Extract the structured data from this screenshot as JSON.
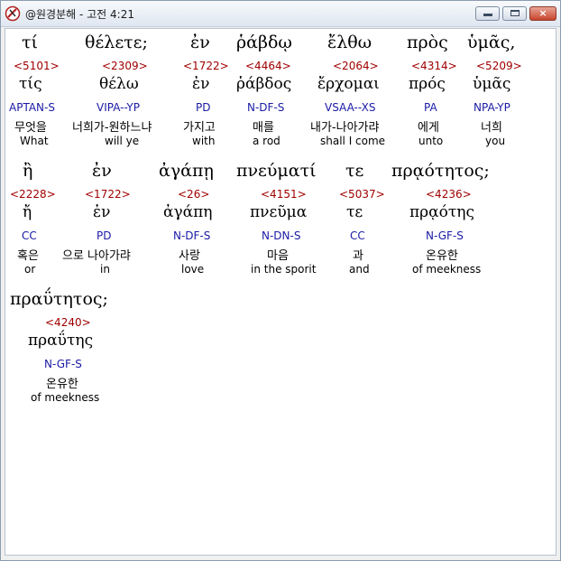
{
  "window": {
    "title": "@원경분해 - 고전 4:21",
    "buttons": {
      "minimize": "minimize-button",
      "maximize": "maximize-button",
      "close": "×"
    }
  },
  "colors": {
    "strong": "#a00000",
    "morph": "#1a1aa6",
    "text": "#000000"
  },
  "words": [
    {
      "greek": "τί",
      "strong": "<5101>",
      "lemma": "τίς",
      "morph": "APTAN-S",
      "korean": "무엇을",
      "english": "What"
    },
    {
      "greek": "θέλετε;",
      "strong": "<2309>",
      "lemma": "θέλω",
      "morph": "VIPA--YP",
      "korean": "너희가-원하느냐",
      "english": "will ye"
    },
    {
      "greek": "ἐν",
      "strong": "<1722>",
      "lemma": "ἐν",
      "morph": "PD",
      "korean": "가지고",
      "english": "with"
    },
    {
      "greek": "ῥάβδῳ",
      "strong": "<4464>",
      "lemma": "ῥάβδος",
      "morph": "N-DF-S",
      "korean": "매를",
      "english": "a rod"
    },
    {
      "greek": "ἔλθω",
      "strong": "<2064>",
      "lemma": "ἔρχομαι",
      "morph": "VSAA--XS",
      "korean": "내가-나아가랴",
      "english": "shall I come"
    },
    {
      "greek": "πρὸς",
      "strong": "<4314>",
      "lemma": "πρός",
      "morph": "PA",
      "korean": "에게",
      "english": "unto"
    },
    {
      "greek": "ὑμᾶς,",
      "strong": "<5209>",
      "lemma": "ὑμᾶς",
      "morph": "NPA-YP",
      "korean": "너희",
      "english": "you"
    },
    {
      "greek": "ἢ",
      "strong": "<2228>",
      "lemma": "ἤ",
      "morph": "CC",
      "korean": "혹은",
      "english": "or"
    },
    {
      "greek": "ἐν",
      "strong": "<1722>",
      "lemma": "ἐν",
      "morph": "PD",
      "korean": "으로 나아가랴",
      "english": "in"
    },
    {
      "greek": "ἀγάπῃ",
      "strong": "<26>",
      "lemma": "ἀγάπη",
      "morph": "N-DF-S",
      "korean": "사랑",
      "english": "love"
    },
    {
      "greek": "πνεύματί",
      "strong": "<4151>",
      "lemma": "πνεῦμα",
      "morph": "N-DN-S",
      "korean": "마음",
      "english": "in the sporit"
    },
    {
      "greek": "τε",
      "strong": "<5037>",
      "lemma": "τε",
      "morph": "CC",
      "korean": "과",
      "english": "and"
    },
    {
      "greek": "πρᾳότητος;",
      "strong": "<4236>",
      "lemma": "πρᾳότης",
      "morph": "N-GF-S",
      "korean": "온유한",
      "english": "of meekness"
    },
    {
      "greek": "πραΰτητος;",
      "strong": "<4240>",
      "lemma": "πραΰτης",
      "morph": "N-GF-S",
      "korean": "온유한",
      "english": "of meekness"
    }
  ]
}
